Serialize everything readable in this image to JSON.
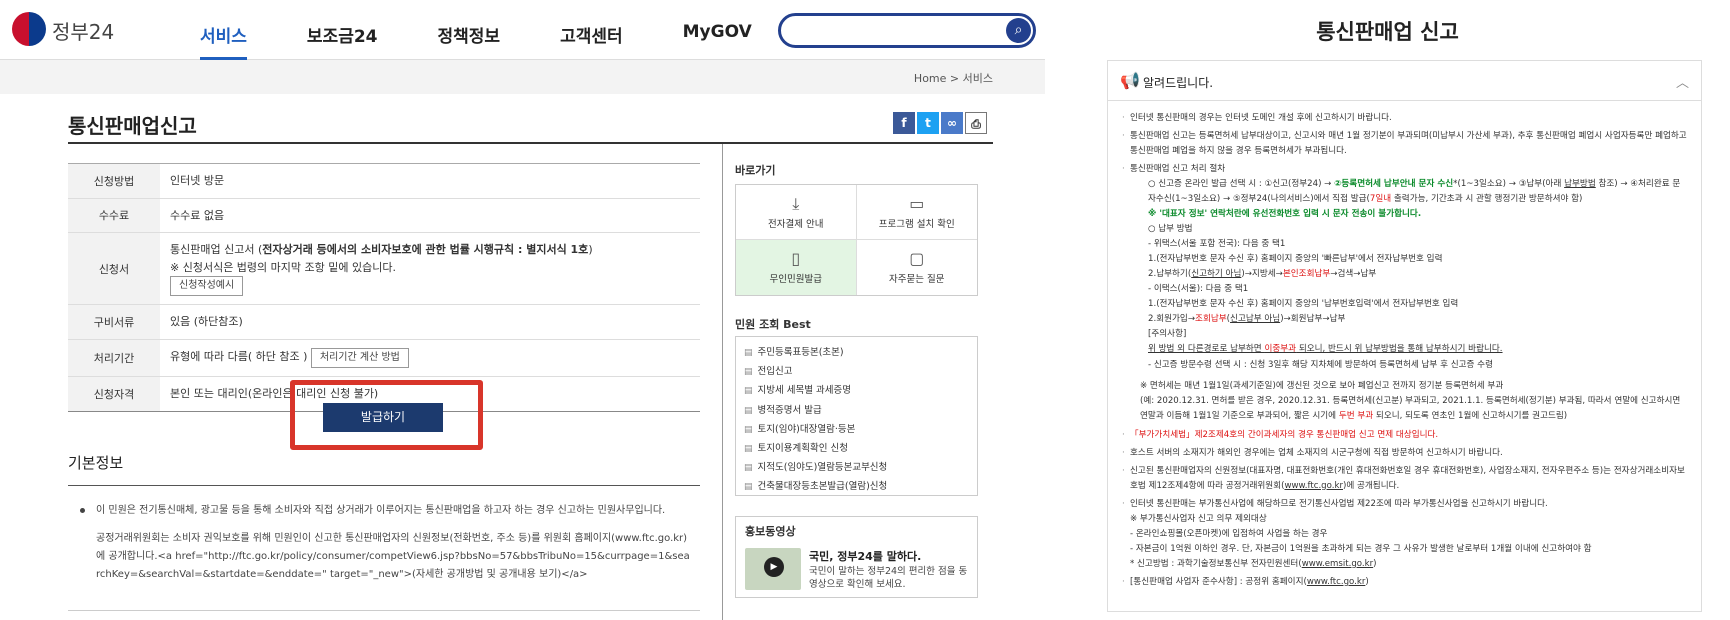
{
  "header": {
    "logo_text": "정부24",
    "nav": [
      "서비스",
      "보조금24",
      "정책정보",
      "고객센터",
      "MyGOV"
    ],
    "search_placeholder": ""
  },
  "breadcrumb": {
    "home": "Home",
    "sep": ">",
    "current": "서비스"
  },
  "page": {
    "title": "통신판매업신고"
  },
  "info": {
    "method_label": "신청방법",
    "method": "인터넷 방문",
    "fee_label": "수수료",
    "fee": "수수료 없음",
    "form_label": "신청서",
    "form_line1_a": "통신판매업 신고서 (",
    "form_line1_b": "전자상거래 등에서의 소비자보호에 관한 법률 시행규칙 : 별지서식 1호",
    "form_line1_c": ")",
    "form_line2": "※ 신청서식은 법령의 마지막 조항 밑에 있습니다.",
    "form_btn": "신청작성예시",
    "docs_label": "구비서류",
    "docs": "있음 (하단참조)",
    "period_label": "처리기간",
    "period": "유형에 따라 다름( 하단 참조 )",
    "period_btn": "처리기간 계산 방법",
    "eligibility_label": "신청자격",
    "eligibility": "본인 또는 대리인(온라인은 대리인 신청 불가)"
  },
  "issue_button": "발급하기",
  "basic": {
    "title": "기본정보",
    "p1": "이 민원은 전기통신매체, 광고물 등을 통해 소비자와 직접 상거래가 이루어지는 통신판매업을 하고자 하는 경우 신고하는 민원사무입니다.",
    "p2": "공정거래위원회는 소비자 권익보호를 위해 민원인이 신고한 통신판매업자의 신원정보(전화번호, 주소 등)를 위원회 홈페이지(www.ftc.go.kr)에 공개합니다.<a href=\"http://ftc.go.kr/policy/consumer/competView6.jsp?bbsNo=57&bbsTribuNo=15&currpage=1&searchKey=&searchVal=&startdate=&enddate=\" target=\"_new\">(자세한 공개방법 및 공개내용 보기)</a>"
  },
  "sidebar": {
    "quick_title": "바로가기",
    "quick": [
      "전자결제 안내",
      "프로그램 설치 확인",
      "무인민원발급",
      "자주묻는 질문"
    ],
    "best_title": "민원 조회 Best",
    "best": [
      "주민등록표등본(초본)",
      "전입신고",
      "지방세 세목별 과세증명",
      "병적증명서 발급",
      "토지(임야)대장열람·등본",
      "토지이용계획확인 신청",
      "지적도(임야도)열람등본교부신청",
      "건축물대장등초본발급(열람)신청"
    ],
    "promo_title": "홍보동영상",
    "promo_head": "국민, 정부24를 말하다.",
    "promo_desc": "국민이 말하는 정부24의 편리한 점을 동영상으로 확인해 보세요."
  },
  "notice_panel": {
    "title": "통신판매업 신고",
    "header": "알려드립니다.",
    "l1": "인터넷 통신판매의 경우는 인터넷 도메인 개설 후에 신고하시기 바랍니다.",
    "l2": "통신판매업 신고는 등록면허세 납부대상이고, 신고시와 매년 1월 정기분이 부과되며(미납부시 가산세 부과), 추후 통신판매업 폐업시 사업자등록만 폐업하고 통신판매업 폐업을 하지 않을 경우 등록면허세가 부과됩니다.",
    "l3": "통신판매업 신고 처리 절차",
    "l3a_1": "○ 신고증 온라인 발급 선택 시 : ①신고(정부24) → ",
    "l3a_2": "②등록면허세 납부안내 문자 수신",
    "l3a_3": "*(1~3일소요) → ③납부(아래 ",
    "l3a_4": "납부방법",
    "l3a_5": " 참조) → ④처리완료 문자수신(1~3일소요) → ⑤정부24(나의서비스)에서 직접 발급(",
    "l3a_6": "7일내",
    "l3a_7": " 출력가능, 기간초과 시 관할 행정기관 방문하셔야 함)",
    "l3b": "※ '대표자 정보' 연락처란에 유선전화번호 입력 시 문자 전송이 불가합니다.",
    "l3c": "○ 납부 방법",
    "l3d": "- 위택스(서울 포함 전국): 다음 중 택1",
    "l3e": "1.(전자납부번호 문자 수신 후) 홈페이지 중앙의 '빠른납부'에서 전자납부번호 입력",
    "l3f_1": "2.납부하기(",
    "l3f_2": "신고하기 아님",
    "l3f_3": ")→지방세→",
    "l3f_4": "본인조회납부",
    "l3f_5": "→검색→납부",
    "l3g": "- 이택스(서울): 다음 중 택1",
    "l3h": "1.(전자납부번호 문자 수신 후) 홈페이지 중앙의 '납부번호입력'에서 전자납부번호 입력",
    "l3i_1": "2.회원가입→",
    "l3i_2": "조회납부",
    "l3i_3": "(",
    "l3i_4": "신고납부 아님",
    "l3i_5": ")→회원납부→납부",
    "l3j": "[주의사항]",
    "l3k_1": "위 방법 외 다른경로로 납부하면 ",
    "l3k_2": "이중부과",
    "l3k_3": " 되오니, 반드시 위 납부방법을 통해 납부하시기 바랍니다.",
    "l3l": "- 신고증 방문수령 선택 시 : 신청 3일후 해당 지차체에 방문하여 등록면허세 납부 후 신고증 수령",
    "l4": "※ 면허세는 매년 1월1일(과세기준일)에 갱신된 것으로 보아 폐업신고 전까지 정기분 등록면허세 부과",
    "l4b_1": "(예: 2020.12.31. 면허를 받은 경우, 2020.12.31. 등록면허세(신고분) 부과되고, 2021.1.1. 등록면허세(정기분) 부과됨, 따라서 연말에 신고하시면 연말과 이듬해 1월1일 기준으로 부과되어, 짧은 시기에 ",
    "l4b_2": "두번 부과",
    "l4b_3": " 되오니, 되도록 연초인 1월에 신고하시기를 권고드림)",
    "l5": "「부가가치세법」제2조제4호의 간이과세자의 경우 통신판매업 신고 면제 대상입니다.",
    "l6": "호스트 서버의 소재지가 해외인 경우에는 업체 소재지의 시군구청에 직접 방문하여 신고하시기 바랍니다.",
    "l7_1": "신고된 통신판매업자의 신원정보(대표자명, 대표전화번호(개인 휴대전화번호일 경우 휴대전화번호), 사업장소재지, 전자우편주소 등)는 전자상거래소비자보호법 제12조제4항에 따라 공정거래위원회(",
    "l7_2": "www.ftc.go.kr",
    "l7_3": ")에 공개됩니다.",
    "l8": "인터넷 통신판매는 부가통신사업에 해당하므로 전기통신사업법 제22조에 따라 부가통신사업을 신고하시기 바랍니다.",
    "l8a": "※ 부가통신사업자 신고 의무 제외대상",
    "l8b": "- 온라인쇼핑몰(오픈마켓)에 입점하여 사업을 하는 경우",
    "l8c": "- 자본금이 1억원 이하인 경우. 단, 자본금이 1억원을 초과하게 되는 경우 그 사유가 발생한 날로부터 1개월 이내에 신고하여야 함",
    "l8d_1": "* 신고방법 : 과학기술정보통신부 전자민원센터(",
    "l8d_2": "www.emsit.go.kr",
    "l8d_3": ")",
    "l9_1": "[통신판매업 사업자 준수사항] : 공정위 홈페이지(",
    "l9_2": "www.ftc.go.kr",
    "l9_3": ")"
  }
}
